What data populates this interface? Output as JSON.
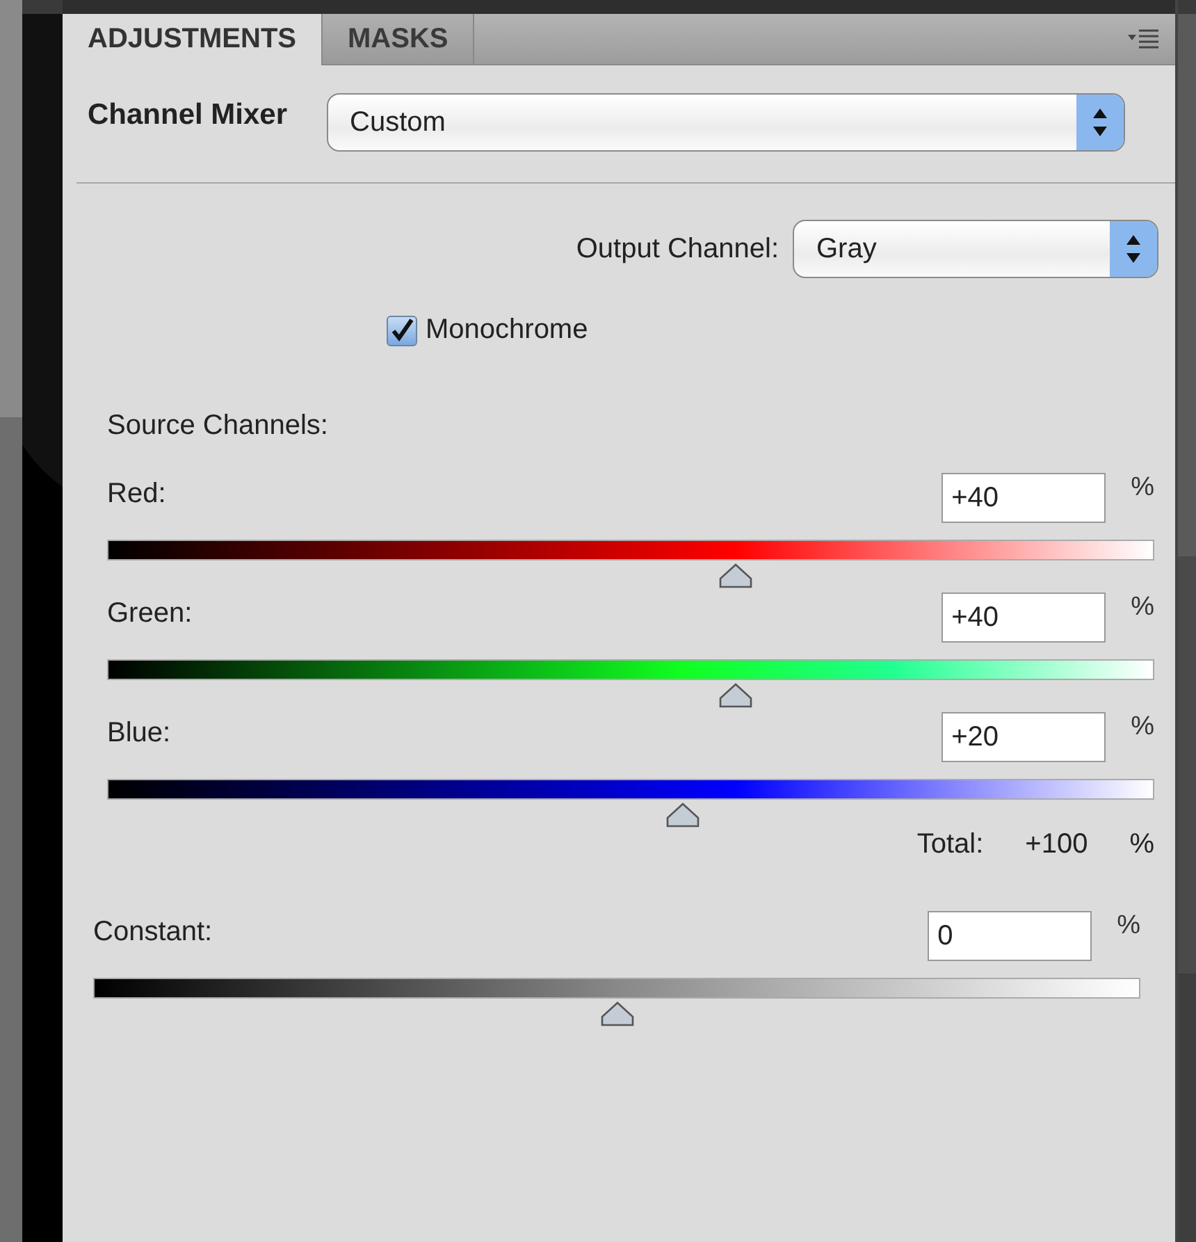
{
  "tabs": [
    {
      "label": "ADJUSTMENTS",
      "selected": true
    },
    {
      "label": "MASKS",
      "selected": false
    }
  ],
  "adjustment": {
    "label": "Channel Mixer",
    "preset": "Custom"
  },
  "output_channel": {
    "label": "Output Channel:",
    "value": "Gray"
  },
  "monochrome": {
    "label": "Monochrome",
    "checked": true
  },
  "source_channels_label": "Source Channels:",
  "channels": [
    {
      "name": "Red:",
      "value": "+40",
      "unit": "%",
      "level": 0.6,
      "kind": "red"
    },
    {
      "name": "Green:",
      "value": "+40",
      "unit": "%",
      "level": 0.6,
      "kind": "green"
    },
    {
      "name": "Blue:",
      "value": "+20",
      "unit": "%",
      "level": 0.55,
      "kind": "blue"
    }
  ],
  "total": {
    "label": "Total:",
    "value": "+100",
    "unit": "%"
  },
  "constant": {
    "name": "Constant:",
    "value": "0",
    "unit": "%",
    "level": 0.5
  }
}
